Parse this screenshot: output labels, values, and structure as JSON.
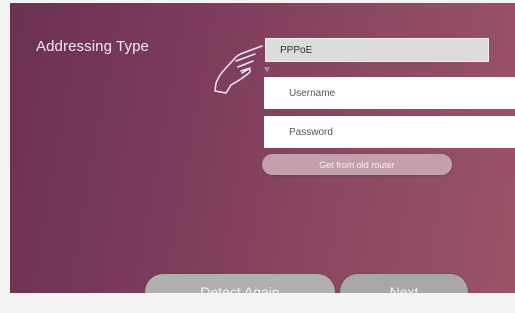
{
  "form": {
    "addressing_type_label": "Addressing Type",
    "addressing_type_value": "PPPoE",
    "username_placeholder": "Username",
    "password_placeholder": "Password",
    "get_from_old_router_label": "Get from old router"
  },
  "footer": {
    "detect_again_label": "Detect Again",
    "next_label": "Next"
  },
  "colors": {
    "background_start": "#6a3150",
    "background_end": "#9a5468",
    "button_gray": "#b0b0b0",
    "pill_pink": "#c4a0ae"
  },
  "icons": {
    "pointer": "hand-pointer-icon",
    "dropdown": "caret-down-icon"
  }
}
